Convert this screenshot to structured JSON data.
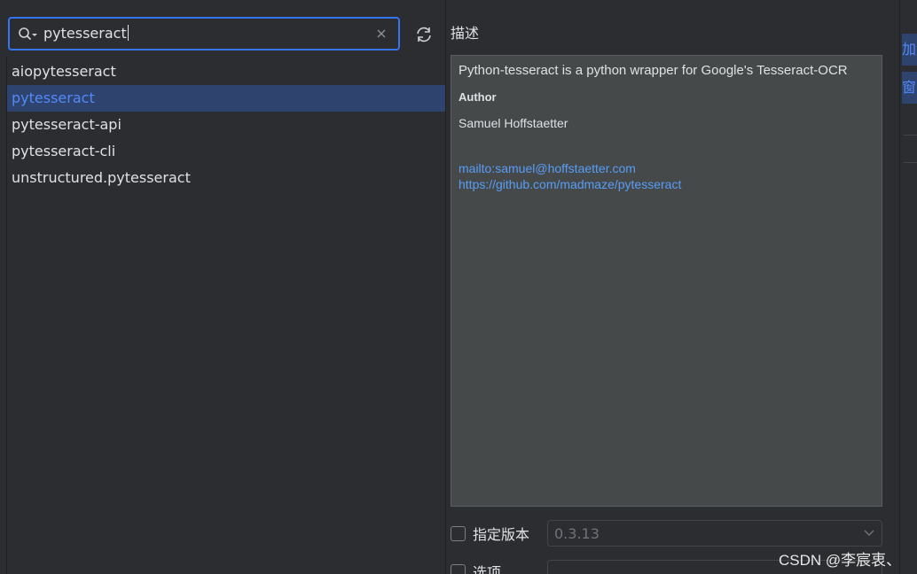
{
  "search": {
    "value": "pytesseract"
  },
  "packages": [
    {
      "name": "aiopytesseract"
    },
    {
      "name": "pytesseract"
    },
    {
      "name": "pytesseract-api"
    },
    {
      "name": "pytesseract-cli"
    },
    {
      "name": "unstructured.pytesseract"
    }
  ],
  "selected_index": 1,
  "description": {
    "title": "描述",
    "summary": "Python-tesseract is a python wrapper for Google's Tesseract-OCR",
    "author_label": "Author",
    "author_name": "Samuel Hoffstaetter",
    "links": [
      "mailto:samuel@hoffstaetter.com",
      "https://github.com/madmaze/pytesseract"
    ]
  },
  "version": {
    "checkbox_label": "指定版本",
    "selected": "0.3.13"
  },
  "options": {
    "checkbox_label": "选项"
  },
  "side_panel": {
    "button1_text": "加解",
    "button2_text": "窗"
  },
  "watermark": "CSDN @李宸衷、",
  "colors": {
    "accent": "#3574f0",
    "selection_bg": "#2e436e",
    "selection_text": "#548af7",
    "link": "#589df6",
    "background": "#2b2d30",
    "description_bg": "#45494a"
  }
}
